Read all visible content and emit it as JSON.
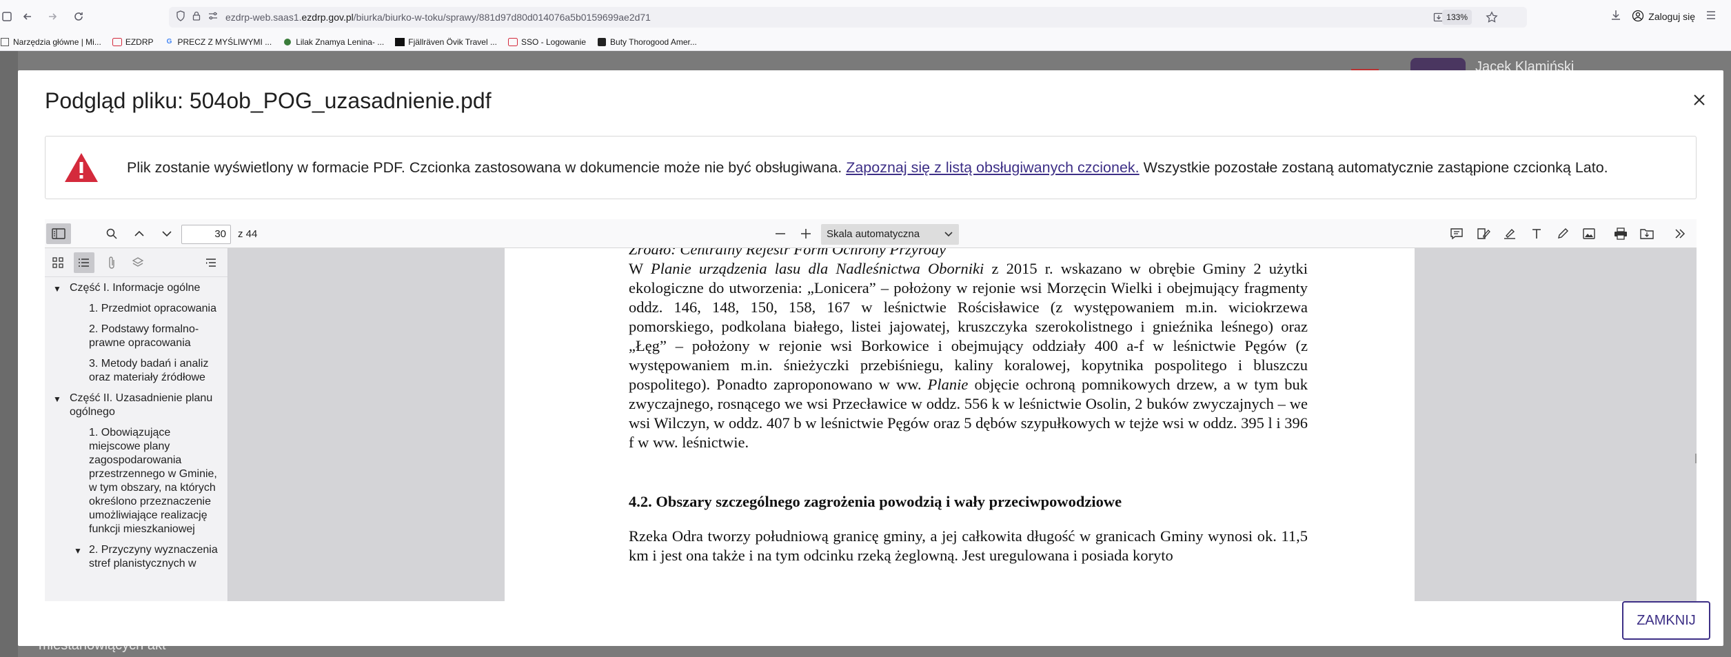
{
  "browser": {
    "url_prefix": "ezdrp-web.saas1.",
    "url_domain": "ezdrp.gov.pl",
    "url_path": "/biurka/biurko-w-toku/sprawy/881d97d80d014076a5b0159699ae2d71",
    "zoom": "133%",
    "login_label": "Zaloguj się"
  },
  "bookmarks": [
    {
      "label": "Narzędzia główne | Mi...",
      "icon": "sharepoint-icon"
    },
    {
      "label": "EZDRP",
      "icon": "ezdrp-icon"
    },
    {
      "label": "PRECZ Z MYŚLIWYMI ...",
      "icon": "google-icon"
    },
    {
      "label": "Lilak Znamya Lenina- ...",
      "icon": "leaf-icon"
    },
    {
      "label": "Fjällräven Övik Travel ...",
      "icon": "fjallraven-icon"
    },
    {
      "label": "SSO - Logowanie",
      "icon": "ezdrp-icon"
    },
    {
      "label": "Buty Thorogood Amer...",
      "icon": "bookmark-icon"
    }
  ],
  "underlay": {
    "user_name": "Jacek Klamiński",
    "bottom_text": "miestanowiących akt"
  },
  "modal": {
    "title": "Podgląd pliku: 504ob_POG_uzasadnienie.pdf",
    "alert_text_before": "Plik zostanie wyświetlony w formacie PDF. Czcionka zastosowana w dokumencie może nie być obsługiwana. ",
    "alert_link": "Zapoznaj się z listą obsługiwanych czcionek.",
    "alert_text_after": " Wszystkie pozostałe zostaną automatycznie zastąpione czcionką Lato.",
    "close_button": "ZAMKNIJ",
    "colors": {
      "accent": "#3d2f86",
      "alert_red": "#d42a3c"
    }
  },
  "viewer": {
    "page_number": "30",
    "page_total": "z 44",
    "scale": "Skala automatyczna",
    "outline": [
      {
        "label": "Część I. Informacje ogólne",
        "level": 0
      },
      {
        "label": "1. Przedmiot opracowania",
        "level": 1
      },
      {
        "label": "2. Podstawy formalno-prawne opracowania",
        "level": 1
      },
      {
        "label": "3. Metody badań i analiz oraz materiały źródłowe",
        "level": 1
      },
      {
        "label": "Część II. Uzasadnienie planu ogólnego",
        "level": 0
      },
      {
        "label": "1. Obowiązujące miejscowe plany zagospodarowania przestrzennego w Gminie, w tym obszary, na których określono przeznaczenie umożliwiające realizację funkcji mieszkaniowej",
        "level": 1
      },
      {
        "label": "2. Przyczyny wyznaczenia stref planistycznych w",
        "level": 1
      }
    ]
  },
  "pdf": {
    "source_line": "Źródło: Centralny Rejestr Form Ochrony Przyrody",
    "p1_a": "W ",
    "p1_b": "Planie urządzenia lasu dla Nadleśnictwa Oborniki",
    "p1_c": " z 2015 r. wskazano w obrębie Gminy 2 użytki ekologiczne do utworzenia: „Lonicera” – położony w rejonie wsi Morzęcin Wielki i obejmujący fragmenty oddz. 146, 148, 150, 158, 167 w leśnictwie Rościsławice (z występowaniem m.in. wiciokrzewa pomorskiego, podkolana białego, listei jajowatej, kruszczyka szerokolistnego i gnieźnika leśnego) oraz „Łęg” – położony w rejonie wsi Borkowice i obejmujący oddziały 400 a-f w leśnictwie Pęgów (z występowaniem m.in. śnieżyczki przebiśniegu, kaliny koralowej, kopytnika pospolitego i bluszczu pospolitego). Ponadto zaproponowano w ww. ",
    "p1_d": "Planie",
    "p1_e": " objęcie ochroną pomnikowych drzew, a w tym buk zwyczajnego, rosnącego we wsi Przecławice w oddz. 556 k w leśnictwie Osolin, 2 buków zwyczajnych – we wsi Wilczyn, w oddz. 407 b w leśnictwie Pęgów oraz 5 dębów szypułkowych w tejże wsi w oddz. 395 l i 396 f w ww. leśnictwie.",
    "heading": "4.2. Obszary szczególnego zagrożenia powodzią i wały przeciwpowodziowe",
    "p2": "Rzeka Odra tworzy południową granicę gminy, a jej całkowita długość w granicach Gminy wynosi ok. 11,5 km i jest ona także i na tym odcinku rzeką żeglowną. Jest uregulowana i posiada koryto"
  }
}
